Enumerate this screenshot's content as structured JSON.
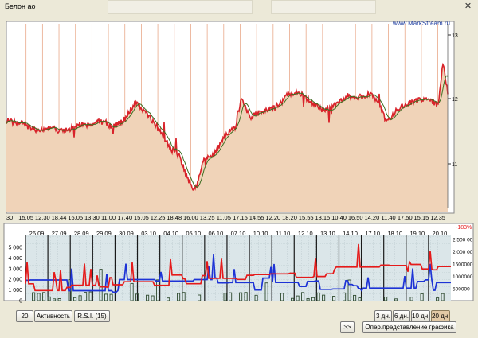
{
  "window": {
    "title": "Белон ао",
    "close_glyph": "✕"
  },
  "price_chart": {
    "watermark": "www.MarkStream.ru",
    "y_ticks": [
      "13",
      "12",
      "11"
    ],
    "x_ticks": [
      "30",
      "15.05",
      "12.30",
      "18.44",
      "16.05",
      "13.30",
      "11.00",
      "17.40",
      "15.05",
      "12.25",
      "18.48",
      "16.00",
      "13.25",
      "11.05",
      "17.15",
      "14.55",
      "12.20",
      "18.20",
      "15.55",
      "13.15",
      "10.40",
      "16.50",
      "14.20",
      "11.40",
      "17.50",
      "15.15",
      "12.35"
    ],
    "colors": {
      "price": "#d8232a",
      "ma": "#3d6e22",
      "fill": "#f0d3b8"
    }
  },
  "indicator_chart": {
    "date_ticks": [
      "26.09",
      "27.09",
      "28.09",
      "29.09",
      "30.09",
      "03.10",
      "04.10",
      "05.10",
      "06.10",
      "07.10",
      "10.10",
      "11.10",
      "12.10",
      "13.10",
      "14.10",
      "17.10",
      "18.10",
      "19.10",
      "20.10"
    ],
    "percent_label": "-183%",
    "left_ticks": [
      "5 000",
      "4 000",
      "3 000",
      "2 000",
      "1 000",
      "0"
    ],
    "right_ticks": [
      "2 500 00",
      "2 000 00",
      "1500000",
      "1000000",
      "500000"
    ],
    "colors": {
      "blue": "#1d33d6",
      "red": "#e51a1a",
      "volume": "#2f4a2f"
    }
  },
  "controls": {
    "period_btn": "20",
    "activity_btn": "Активность",
    "rsi_btn": "R.S.I. (15)",
    "range_3": "3 дн.",
    "range_6": "6 дн.",
    "range_10": "10 дн.",
    "range_20": "20 дн.",
    "forward_btn": ">>",
    "view_btn": "Опер.представление графика"
  }
}
